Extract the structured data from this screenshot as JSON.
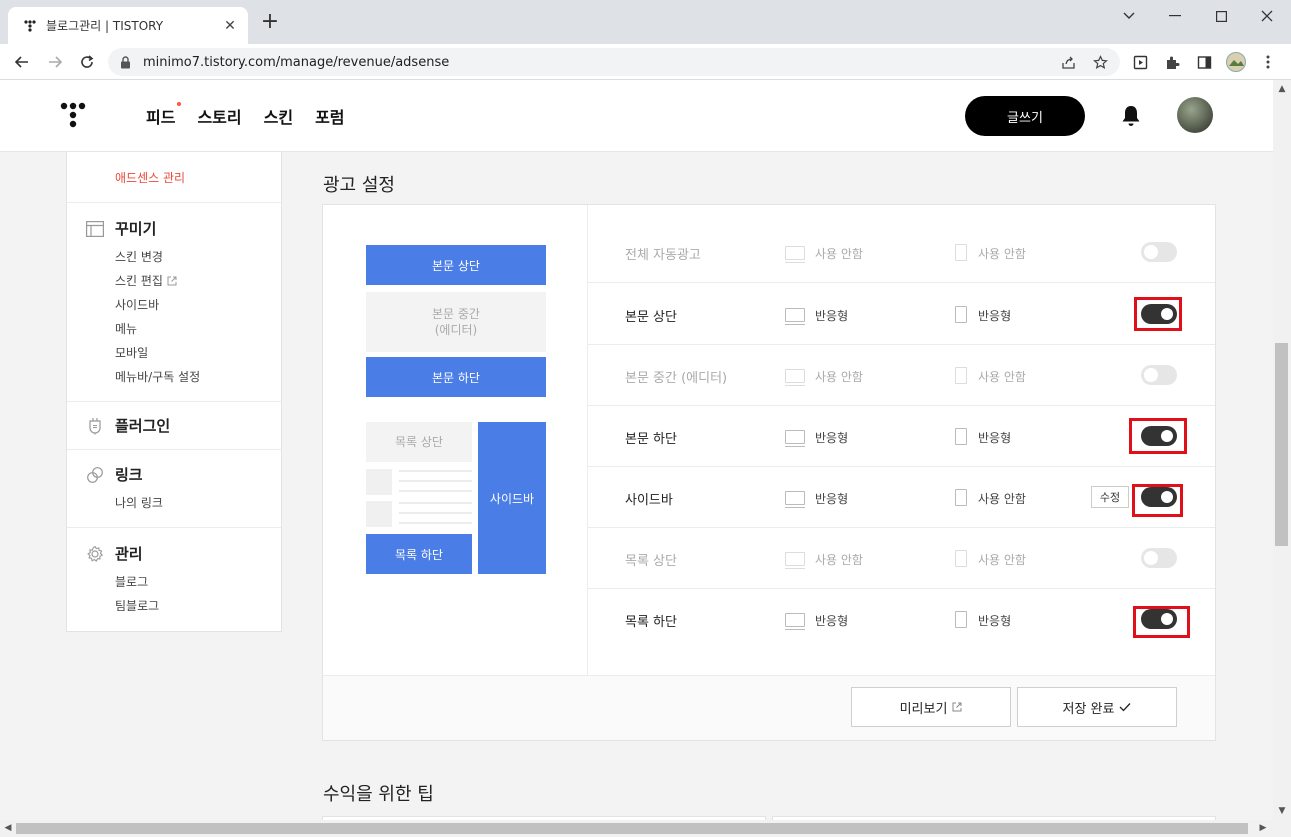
{
  "browser": {
    "tab_title": "블로그관리 | TISTORY",
    "url": "minimo7.tistory.com/manage/revenue/adsense",
    "new_tab_symbol": "+",
    "close_symbol": "✕"
  },
  "topnav": {
    "menu": [
      {
        "label": "피드",
        "notification_dot": true
      },
      {
        "label": "스토리",
        "notification_dot": false
      },
      {
        "label": "스킨",
        "notification_dot": false
      },
      {
        "label": "포럼",
        "notification_dot": false
      }
    ],
    "write_label": "글쓰기"
  },
  "sidebar": {
    "active_item": "애드센스 관리",
    "groups": [
      {
        "title": "꾸미기",
        "icon": "layout-icon",
        "items": [
          "스킨 변경",
          "스킨 편집",
          "사이드바",
          "메뉴",
          "모바일",
          "메뉴바/구독 설정"
        ]
      },
      {
        "title": "플러그인",
        "icon": "plugin-icon",
        "items": []
      },
      {
        "title": "링크",
        "icon": "link-icon",
        "items": [
          "나의 링크"
        ]
      },
      {
        "title": "관리",
        "icon": "gear-icon",
        "items": [
          "블로그",
          "팀블로그"
        ]
      }
    ]
  },
  "main": {
    "section_title": "광고 설정",
    "preview": {
      "body_top": "본문 상단",
      "body_middle_line1": "본문 중간",
      "body_middle_line2": "(에디터)",
      "body_bottom": "본문 하단",
      "list_top": "목록 상단",
      "sidebar": "사이드바",
      "list_bottom": "목록 하단"
    },
    "rows": [
      {
        "label": "전체 자동광고",
        "pc": "사용 안함",
        "mobile": "사용 안함",
        "enabled": false
      },
      {
        "label": "본문 상단",
        "pc": "반응형",
        "mobile": "반응형",
        "enabled": true
      },
      {
        "label": "본문 중간 (에디터)",
        "pc": "사용 안함",
        "mobile": "사용 안함",
        "enabled": false
      },
      {
        "label": "본문 하단",
        "pc": "반응형",
        "mobile": "반응형",
        "enabled": true
      },
      {
        "label": "사이드바",
        "pc": "반응형",
        "mobile": "사용 안함",
        "enabled": true,
        "edit_label": "수정"
      },
      {
        "label": "목록 상단",
        "pc": "사용 안함",
        "mobile": "사용 안함",
        "enabled": false
      },
      {
        "label": "목록 하단",
        "pc": "반응형",
        "mobile": "반응형",
        "enabled": true
      }
    ],
    "preview_button": "미리보기",
    "save_button": "저장 완료",
    "tips_title": "수익을 위한 팁"
  },
  "colors": {
    "accent_blue": "#4a7de5",
    "active_red": "#e94a3a",
    "highlight_red": "#e0101a"
  }
}
